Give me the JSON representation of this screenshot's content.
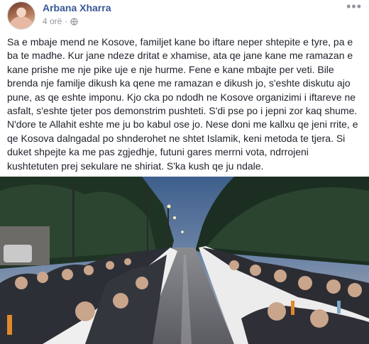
{
  "post": {
    "author": "Arbana Xharra",
    "time": "4 orë",
    "separator": "·",
    "privacy_icon": "globe-icon",
    "more_icon": "more-icon",
    "more_label": "•••",
    "text": "Sa e mbaje mend ne Kosove, familjet kane bo iftare neper shtepite e tyre, pa e ba te madhe. Kur jane ndeze dritat e xhamise, ata qe jane kane me ramazan e kane prishe me nje pike uje e nje hurme. Fene e kane mbajte per veti. Bile brenda nje familje dikush ka qene me ramazan e dikush jo, s'eshte diskutu ajo pune, as qe eshte imponu. Kjo cka po ndodh ne Kosove organizimi i iftareve ne asfalt, s'eshte tjeter pos demonstrim pushteti. S'di pse po i jepni zor kaq shume. N'dore te Allahit eshte me ju bo kabul ose jo. Nese doni me kallxu qe jeni rrite, e qe Kosova dalngadal po shnderohet ne shtet Islamik, keni metoda te tjera. Si duket shpejte ka me pas zgjedhje, futuni gares merrni vota, ndrrojeni kushtetuten prej sekulare ne shiriat. S'ka kush qe ju ndale.",
    "photo": {
      "description_icon": "photo-street-iftar"
    }
  }
}
